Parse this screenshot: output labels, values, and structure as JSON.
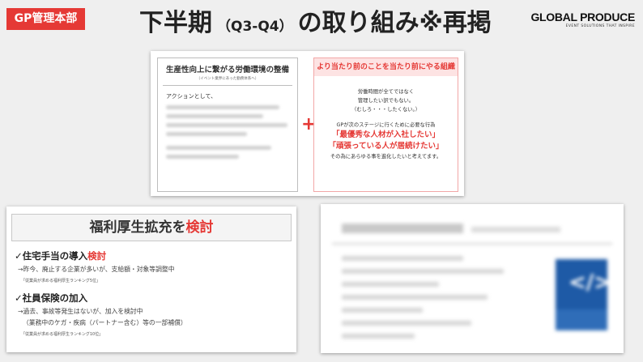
{
  "header": {
    "tag": "GP管理本部",
    "title_main": "下半期",
    "title_sub": "（Q3-Q4）",
    "title_rest": "の取り組み※再掲",
    "logo_name": "GLOBAL PRODUCE",
    "logo_tagline": "EVENT SOLUTIONS THAT INSPIRE"
  },
  "top_card": {
    "left": {
      "heading": "生産性向上に繋がる労働環境の整備",
      "subheading": "（イベント業界にあった勤務体系へ）",
      "action_label": "アクションとして、"
    },
    "plus": "+",
    "right": {
      "heading": "より当たり前のことを当たり前にやる組織",
      "line1": "労働時間が全てではなく",
      "line2": "管理したい訳でもない。",
      "line3": "（むしろ・・・したくない。）",
      "line4": "GPが次のステージに行くために必要な行為",
      "red1": "「最優秀な人材が入社したい」",
      "red2": "「頑張っている人が居続けたい」",
      "line5": "その為にあらゆる事を進化したいと考えてます。"
    }
  },
  "bottom_left": {
    "header_a": "福利厚生拡充を",
    "header_b": "検討",
    "item1_a": "✓住宅手当の導入",
    "item1_b": "検討",
    "item1_detail": "→昨今、廃止する企業が多いが、支給額・対象等調整中",
    "item1_note": "「従業員が求める福利厚生ランキング5位」",
    "item2": "✓社員保険の加入",
    "item2_detail1": "→過去、事故等発生はないが、加入を検討中",
    "item2_detail2": "（業務中のケガ・疾病（パートナー含む）等の一部補償）",
    "item2_note": "「従業員が求める福利厚生ランキング10位」"
  },
  "colors": {
    "accent_red": "#e53935",
    "blue_box": "#1e5aa6"
  }
}
